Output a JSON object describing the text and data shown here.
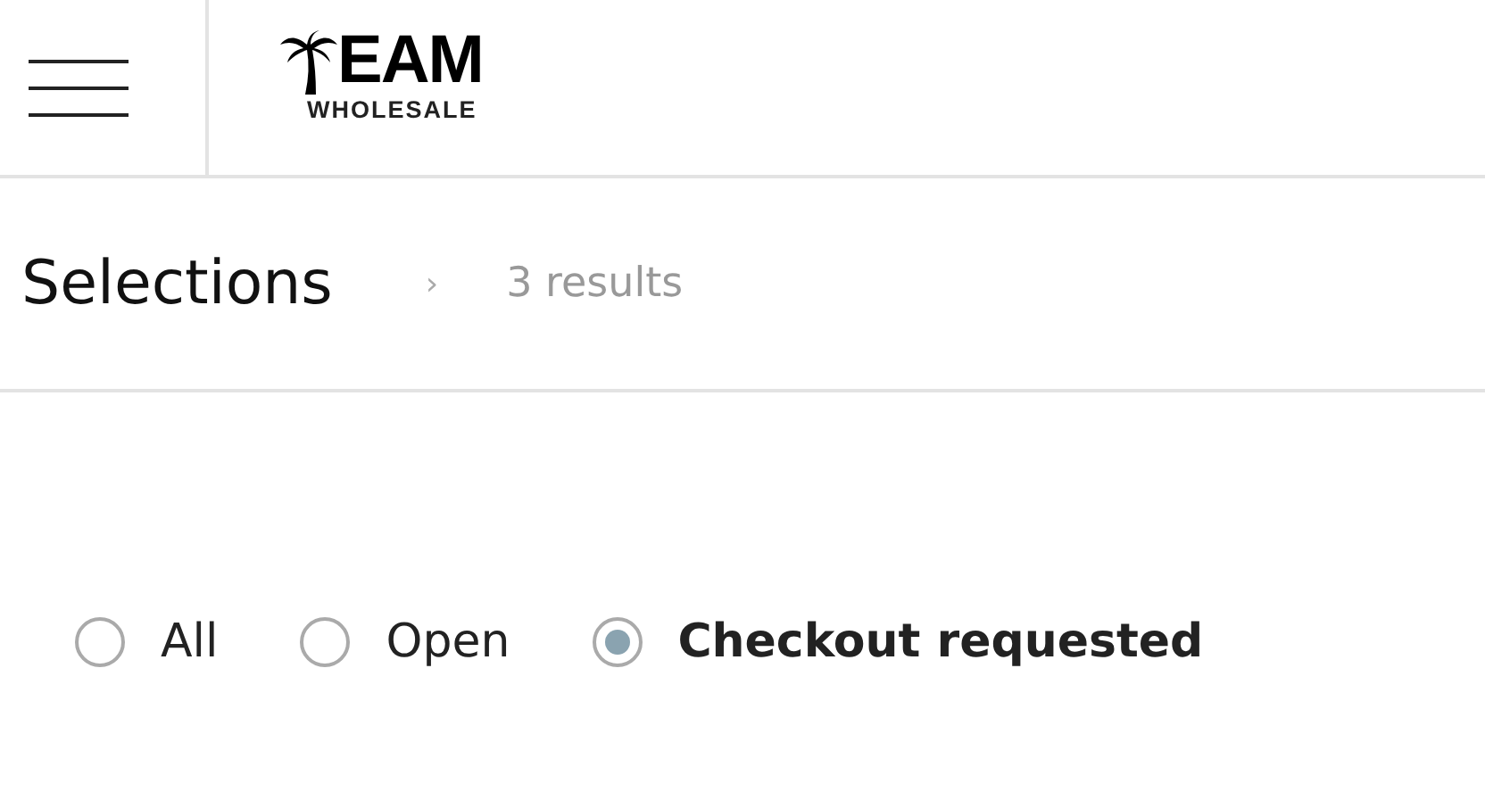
{
  "header": {
    "logo": {
      "word": "EAM",
      "subtitle": "WHOLESALE"
    }
  },
  "page_title": {
    "title": "Selections",
    "separator": "›",
    "count": "3 results"
  },
  "filters": [
    {
      "label": "All",
      "selected": false
    },
    {
      "label": "Open",
      "selected": false
    },
    {
      "label": "Checkout requested",
      "selected": true
    }
  ]
}
